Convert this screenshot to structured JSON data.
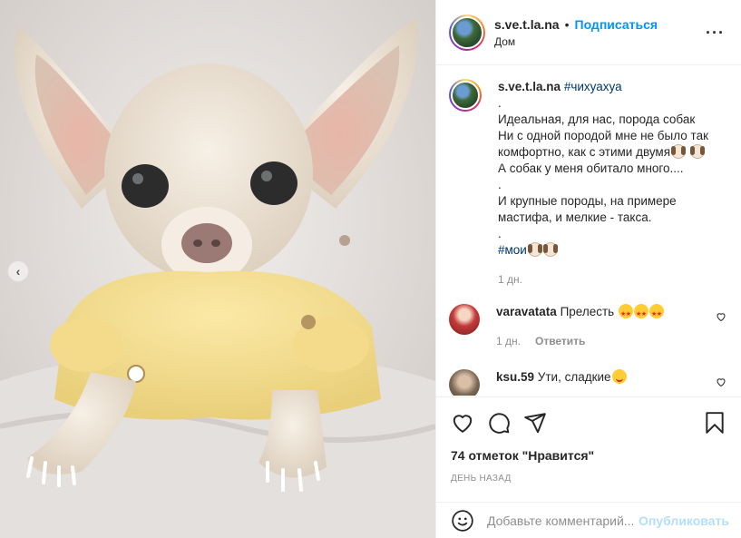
{
  "post": {
    "author": "s.ve.t.la.na",
    "separator": "•",
    "follow_label": "Подписаться",
    "location": "Дом",
    "more_icon": "more-icon"
  },
  "caption": {
    "author": "s.ve.t.la.na",
    "hashtag1": "#чихуахуа",
    "line1": ".",
    "line2": "Идеальная, для нас, порода собак",
    "line3": "Ни с одной породой мне не было так комфортно, как с этими двумя",
    "line4": "А собак у меня обитало много....",
    "line5": ".",
    "line6": "И крупные породы, на примере мастифа, и мелкие - такса.",
    "line7": ".",
    "hashtag2": "#мои",
    "time": "1 дн."
  },
  "comments": [
    {
      "user": "varavatata",
      "text": "Прелесть",
      "time": "1 дн.",
      "reply": "Ответить"
    },
    {
      "user": "ksu.59",
      "text": "Ути, сладкие"
    }
  ],
  "likes_text": "74 отметок \"Нравится\"",
  "date_text": "ДЕНЬ НАЗАД",
  "comment_box": {
    "placeholder": "Добавьте комментарий...",
    "publish_label": "Опубликовать"
  },
  "icons": [
    "heart-icon",
    "comment-icon",
    "share-icon",
    "bookmark-icon",
    "emoji-icon",
    "chevron-left-icon"
  ],
  "colors": {
    "link": "#0095f6",
    "hashtag": "#00376b",
    "muted": "#8e8e8e",
    "publish_disabled": "#b2dffc"
  }
}
